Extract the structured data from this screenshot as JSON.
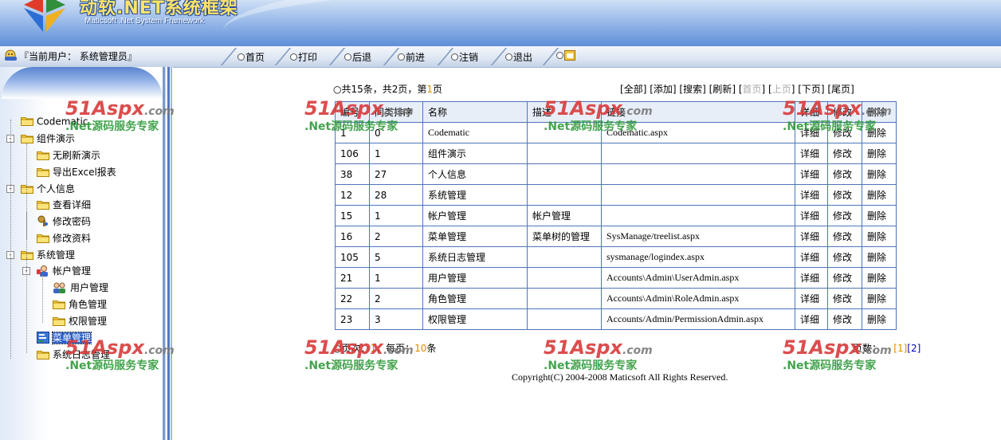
{
  "header": {
    "brand_title": "动软.NET系统框架",
    "brand_subtitle": "Maticsoft .Net System Framework"
  },
  "nav": {
    "current_user": "『当前用户： 系统管理员』",
    "items": [
      {
        "label": "首页"
      },
      {
        "label": "打印"
      },
      {
        "label": "后退"
      },
      {
        "label": "前进"
      },
      {
        "label": "注销"
      },
      {
        "label": "退出"
      }
    ]
  },
  "sidebar": {
    "tree": [
      {
        "label": "Codematic",
        "level": 0,
        "icon": "folder-icon"
      },
      {
        "label": "组件演示",
        "level": 0,
        "icon": "folder-icon"
      },
      {
        "label": "无刷新演示",
        "level": 1,
        "icon": "folder-icon"
      },
      {
        "label": "导出Excel报表",
        "level": 1,
        "icon": "folder-icon"
      },
      {
        "label": "个人信息",
        "level": 0,
        "icon": "folder-icon"
      },
      {
        "label": "查看详细",
        "level": 1,
        "icon": "folder-icon"
      },
      {
        "label": "修改密码",
        "level": 1,
        "icon": "key-icon"
      },
      {
        "label": "修改资料",
        "level": 1,
        "icon": "folder-icon"
      },
      {
        "label": "系统管理",
        "level": 0,
        "icon": "folder-icon"
      },
      {
        "label": "帐户管理",
        "level": 1,
        "icon": "user-icon"
      },
      {
        "label": "用户管理",
        "level": 2,
        "icon": "users-icon"
      },
      {
        "label": "角色管理",
        "level": 2,
        "icon": "folder-icon"
      },
      {
        "label": "权限管理",
        "level": 2,
        "icon": "folder-icon"
      },
      {
        "label": "菜单管理",
        "level": 1,
        "icon": "menu-icon",
        "selected": true
      },
      {
        "label": "系统日志管理",
        "level": 1,
        "icon": "folder-icon"
      }
    ]
  },
  "main": {
    "summary_prefix": "共15条，共2页，第",
    "summary_page": "1",
    "summary_suffix": "页",
    "actions": [
      {
        "label": "全部",
        "enabled": true
      },
      {
        "label": "添加",
        "enabled": true
      },
      {
        "label": "搜索",
        "enabled": true
      },
      {
        "label": "刷新",
        "enabled": true
      },
      {
        "label": "首页",
        "enabled": false
      },
      {
        "label": "上页",
        "enabled": false
      },
      {
        "label": "下页",
        "enabled": true
      },
      {
        "label": "尾页",
        "enabled": true
      }
    ],
    "table": {
      "columns": [
        "编号",
        "同类排序",
        "名称",
        "描述",
        "链接",
        "详细",
        "修改",
        "删除"
      ],
      "rows": [
        [
          "1",
          "0",
          "Codematic",
          "",
          "Codematic.aspx",
          "详细",
          "修改",
          "删除"
        ],
        [
          "106",
          "1",
          "组件演示",
          "",
          "",
          "详细",
          "修改",
          "删除"
        ],
        [
          "38",
          "27",
          "个人信息",
          "",
          "",
          "详细",
          "修改",
          "删除"
        ],
        [
          "12",
          "28",
          "系统管理",
          "",
          "",
          "详细",
          "修改",
          "删除"
        ],
        [
          "15",
          "1",
          "帐户管理",
          "帐户管理",
          "",
          "详细",
          "修改",
          "删除"
        ],
        [
          "16",
          "2",
          "菜单管理",
          "菜单树的管理",
          "SysManage/treelist.aspx",
          "详细",
          "修改",
          "删除"
        ],
        [
          "105",
          "5",
          "系统日志管理",
          "",
          "sysmanage/logindex.aspx",
          "详细",
          "修改",
          "删除"
        ],
        [
          "21",
          "1",
          "用户管理",
          "",
          "Accounts\\Admin\\UserAdmin.aspx",
          "详细",
          "修改",
          "删除"
        ],
        [
          "22",
          "2",
          "角色管理",
          "",
          "Accounts\\Admin\\RoleAdmin.aspx",
          "详细",
          "修改",
          "删除"
        ],
        [
          "23",
          "3",
          "权限管理",
          "",
          "Accounts/Admin/PermissionAdmin.aspx",
          "详细",
          "修改",
          "删除"
        ]
      ]
    },
    "footer_left_prefix": "页次：",
    "footer_left_page": "1",
    "footer_left_mid": "，每页：",
    "footer_left_per": "10",
    "footer_left_suffix": "条",
    "footer_right_label": "页数：",
    "footer_right_pages": [
      "[1]",
      "[2]"
    ],
    "copyright": "Copyright(C) 2004-2008 Maticsoft All Rights Reserved."
  },
  "watermark": {
    "line1_red": "51",
    "line1_mid": "Aspx",
    "line1_gray": ".com",
    "line2": ".Net源码服务专家"
  },
  "colors": {
    "table_border": "#4d76b8",
    "accent_orange": "#e08a00",
    "header_blue": "#5f8fd8"
  }
}
